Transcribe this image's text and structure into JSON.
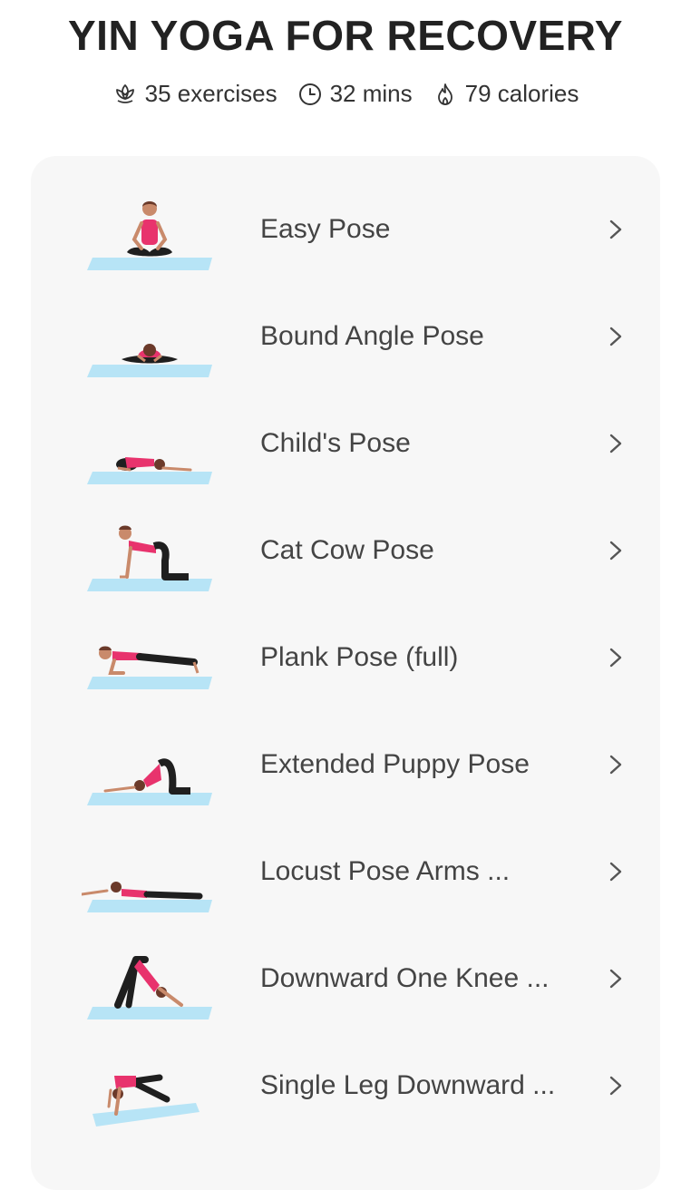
{
  "header": {
    "title": "YIN YOGA FOR RECOVERY",
    "stats": [
      {
        "icon": "lotus-icon",
        "text": "35 exercises"
      },
      {
        "icon": "clock-icon",
        "text": "32 mins"
      },
      {
        "icon": "flame-icon",
        "text": "79 calories"
      }
    ]
  },
  "colors": {
    "mat": "#b7e4f6",
    "top": "#e8336d",
    "pants": "#1f1f1f",
    "skin": "#c98a6b"
  },
  "exercises": [
    {
      "label": "Easy Pose"
    },
    {
      "label": "Bound Angle Pose"
    },
    {
      "label": "Child's Pose"
    },
    {
      "label": "Cat Cow Pose"
    },
    {
      "label": "Plank Pose (full)"
    },
    {
      "label": "Extended Puppy Pose"
    },
    {
      "label": "Locust Pose Arms ..."
    },
    {
      "label": "Downward One Knee ..."
    },
    {
      "label": "Single Leg Downward ..."
    }
  ]
}
